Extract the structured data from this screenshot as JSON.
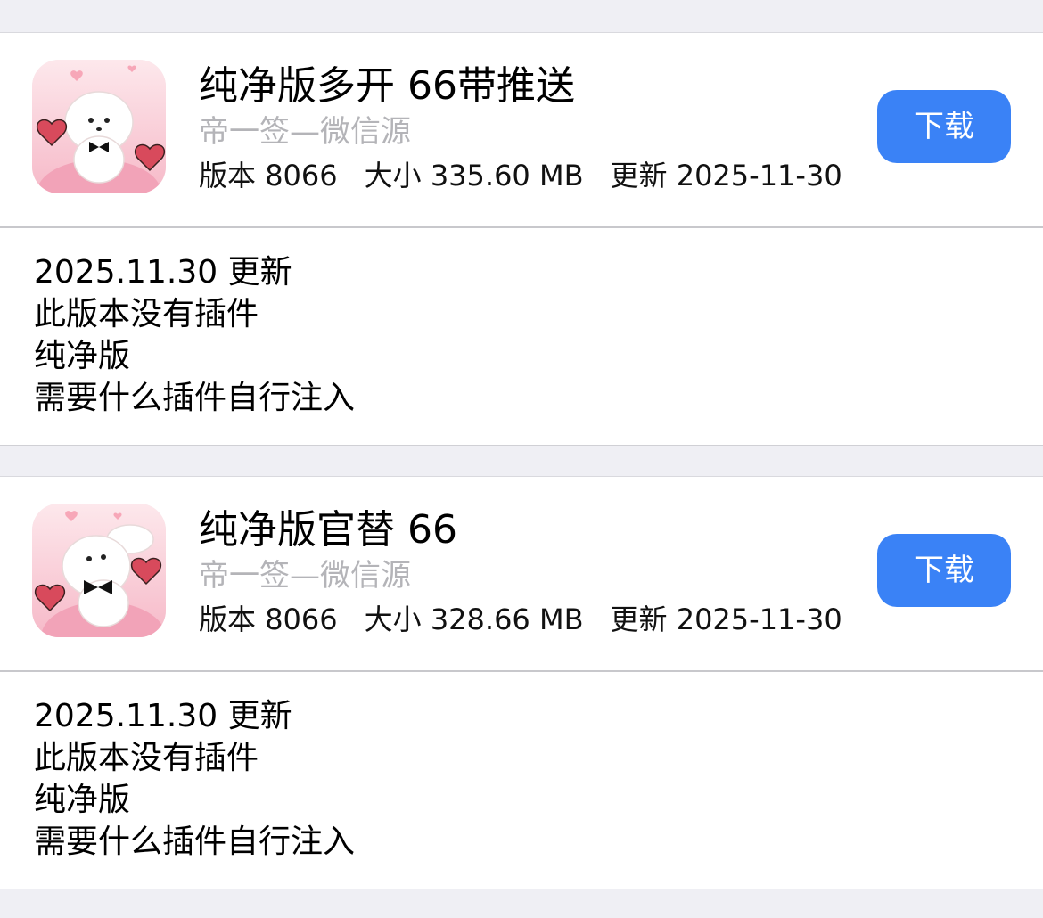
{
  "colors": {
    "page_background": "#efeff4",
    "card_background": "#ffffff",
    "button_blue": "#3a82f6",
    "source_gray": "#b4b4b8"
  },
  "apps": [
    {
      "name": "纯净版多开 66带推送",
      "source": "帝一签—微信源",
      "version_label": "版本",
      "version": "8066",
      "size_label": "大小",
      "size": "335.60 MB",
      "updated_label": "更新",
      "updated": "2025-11-30",
      "download_label": "下载",
      "icon": "poodle-love-hearts-icon",
      "notes": [
        "2025.11.30 更新",
        "此版本没有插件",
        "纯净版",
        "需要什么插件自行注入"
      ]
    },
    {
      "name": "纯净版官替 66",
      "source": "帝一签—微信源",
      "version_label": "版本",
      "version": "8066",
      "size_label": "大小",
      "size": "328.66 MB",
      "updated_label": "更新",
      "updated": "2025-11-30",
      "download_label": "下载",
      "icon": "poodle-love-hearts-icon",
      "notes": [
        "2025.11.30 更新",
        "此版本没有插件",
        "纯净版",
        "需要什么插件自行注入"
      ]
    }
  ]
}
